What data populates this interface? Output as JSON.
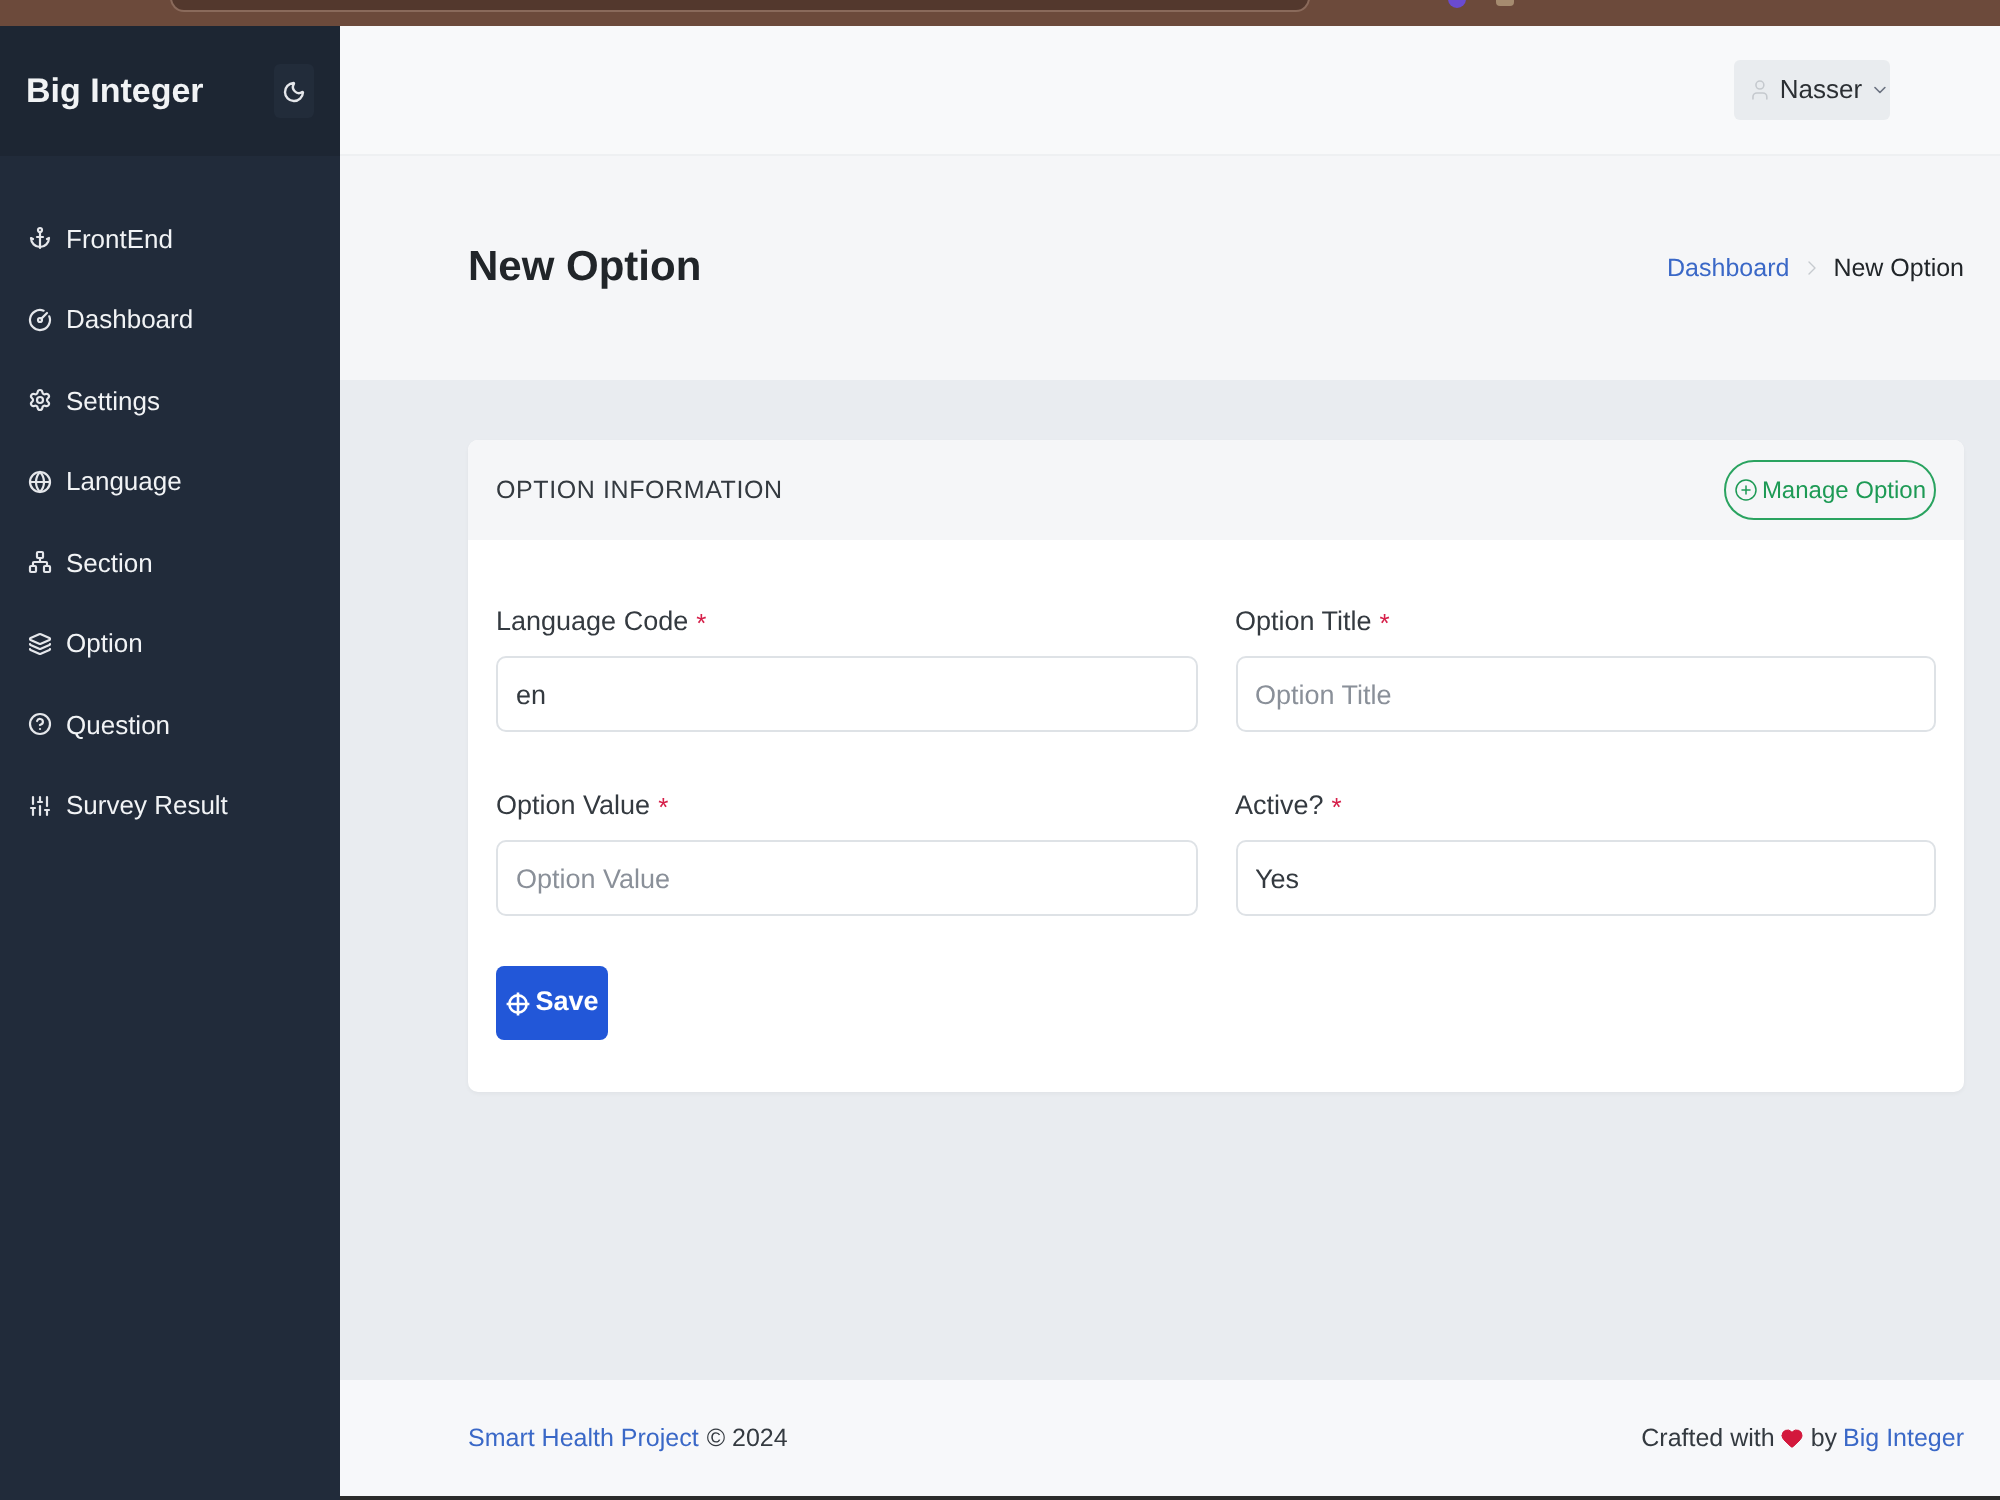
{
  "sidebar": {
    "brand": "Big Integer",
    "items": [
      {
        "label": "FrontEnd"
      },
      {
        "label": "Dashboard"
      },
      {
        "label": "Settings"
      },
      {
        "label": "Language"
      },
      {
        "label": "Section"
      },
      {
        "label": "Option"
      },
      {
        "label": "Question"
      },
      {
        "label": "Survey Result"
      }
    ]
  },
  "topbar": {
    "user": "Nasser"
  },
  "page_header": {
    "title": "New Option",
    "breadcrumb": [
      {
        "label": "Dashboard",
        "kind": "link"
      },
      {
        "label": "New Option",
        "kind": "current"
      }
    ]
  },
  "card": {
    "title": "OPTION INFORMATION",
    "action": "Manage Option",
    "fields": [
      {
        "label": "Language Code",
        "required_mark": "*",
        "value": "en"
      },
      {
        "label": "Option Title",
        "required_mark": "*",
        "placeholder": "Option Title"
      },
      {
        "label": "Option Value",
        "required_mark": "*",
        "placeholder": "Option Value"
      },
      {
        "label": "Active?",
        "required_mark": "*",
        "value": "Yes"
      }
    ],
    "submit": "Save"
  },
  "footer": {
    "project_link": "Smart Health Project",
    "copyright": "© 2024",
    "credit_prefix": "Crafted with",
    "credit_by": "by",
    "author_link": "Big Integer"
  }
}
